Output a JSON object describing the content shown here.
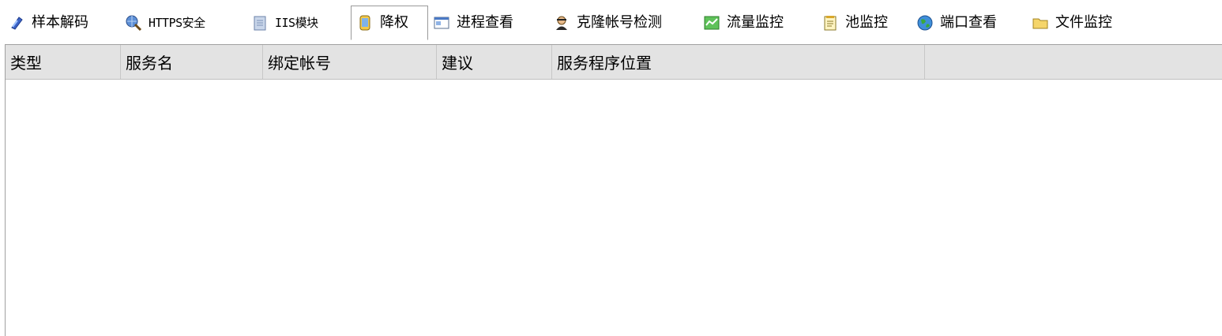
{
  "tabs": [
    {
      "label": "样本解码",
      "icon": "shield-icon",
      "active": false
    },
    {
      "label": "HTTPS安全",
      "icon": "globe-magnifier-icon",
      "active": false
    },
    {
      "label": "IIS模块",
      "icon": "document-icon",
      "active": false
    },
    {
      "label": "降权",
      "icon": "scroll-icon",
      "active": true
    },
    {
      "label": "进程查看",
      "icon": "window-icon",
      "active": false
    },
    {
      "label": "克隆帐号检测",
      "icon": "user-spy-icon",
      "active": false
    },
    {
      "label": "流量监控",
      "icon": "chart-icon",
      "active": false
    },
    {
      "label": "池监控",
      "icon": "notepad-icon",
      "active": false
    },
    {
      "label": "端口查看",
      "icon": "globe-icon",
      "active": false
    },
    {
      "label": "文件监控",
      "icon": "folder-icon",
      "active": false
    }
  ],
  "table": {
    "columns": [
      "类型",
      "服务名",
      "绑定帐号",
      "建议",
      "服务程序位置",
      ""
    ],
    "rows": []
  },
  "colors": {
    "header_bg": "#e3e3e3",
    "border": "#a0a0a0"
  }
}
